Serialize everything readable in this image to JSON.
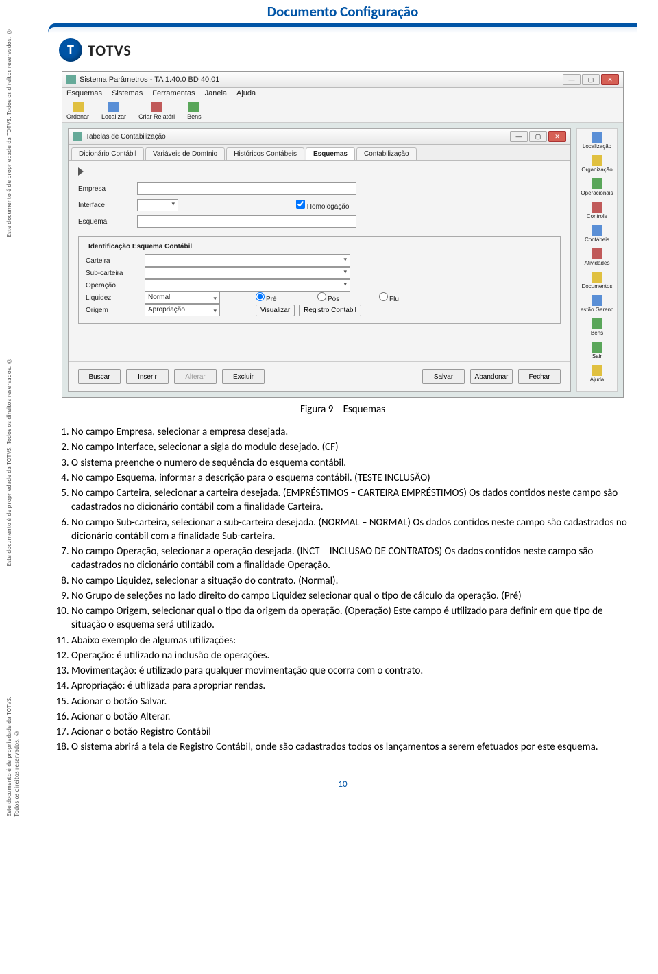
{
  "doc_title": "Documento Configuração",
  "brand": "TOTVS",
  "side_copyright": "Este documento é de propriedade da TOTVS. Todos os direitos reservados. ©",
  "outer_window": {
    "title": "Sistema Parâmetros - TA 1.40.0 BD 40.01",
    "menus": [
      "Esquemas",
      "Sistemas",
      "Ferramentas",
      "Janela",
      "Ajuda"
    ],
    "toolbar": [
      "Ordenar",
      "Localizar",
      "Criar Relatóri",
      "Bens"
    ]
  },
  "inner_window": {
    "title": "Tabelas de Contabilização",
    "tabs": [
      "Dicionário Contábil",
      "Variáveis de Domínio",
      "Históricos Contábeis",
      "Esquemas",
      "Contabilização"
    ],
    "active_tab": "Esquemas",
    "fields": {
      "empresa": "Empresa",
      "interface": "Interface",
      "esquema": "Esquema",
      "homolog": "Homologação",
      "legend": "Identificação Esquema Contábil",
      "carteira": "Carteira",
      "subcarteira": "Sub-carteira",
      "operacao": "Operação",
      "liquidez": "Liquidez",
      "liquidez_val": "Normal",
      "radio_pre": "Pré",
      "radio_pos": "Pós",
      "radio_flu": "Flu",
      "origem": "Origem",
      "origem_val": "Apropriação",
      "visualizar": "Visualizar",
      "registro": "Registro Contabil"
    },
    "buttons": [
      "Buscar",
      "Inserir",
      "Alterar",
      "Excluir",
      "Salvar",
      "Abandonar",
      "Fechar"
    ]
  },
  "side_tools": [
    "Localização",
    "Organização",
    "Operacionais",
    "Controle",
    "Contábeis",
    "Atividades",
    "Documentos",
    "estão Gerenc",
    "Bens",
    "Sair",
    "Ajuda"
  ],
  "figure_caption": "Figura 9 – Esquemas",
  "steps": [
    "No campo Empresa, selecionar a empresa desejada.",
    "No campo Interface, selecionar a sigla do modulo desejado. (CF)",
    "O sistema preenche o numero de sequência do esquema contábil.",
    "No campo Esquema, informar a descrição para o esquema contábil. (TESTE INCLUSÃO)",
    "No campo Carteira, selecionar a carteira desejada. (EMPRÉSTIMOS – CARTEIRA EMPRÉSTIMOS) Os dados contidos neste campo são cadastrados no dicionário contábil com a finalidade Carteira.",
    "No campo Sub-carteira, selecionar a sub-carteira desejada. (NORMAL – NORMAL) Os dados contidos neste campo são cadastrados no dicionário contábil com a finalidade Sub-carteira.",
    "No campo Operação, selecionar a operação desejada. (INCT – INCLUSAO DE CONTRATOS) Os dados contidos neste campo são cadastrados no dicionário contábil com a finalidade Operação.",
    "No campo Liquidez, selecionar a situação do contrato. (Normal).",
    "No Grupo de seleções no lado direito do campo Liquidez selecionar qual o tipo de cálculo da operação. (Pré)",
    "No campo Origem, selecionar qual o tipo da origem da operação. (Operação) Este campo é utilizado para definir em que tipo de situação o esquema será utilizado.",
    "Abaixo exemplo de algumas utilizações:",
    "Operação: é utilizado na inclusão de operações.",
    "Movimentação: é utilizado para qualquer movimentação que ocorra com o contrato.",
    "Apropriação: é utilizada para apropriar rendas.",
    "Acionar o botão Salvar.",
    "Acionar o botão Alterar.",
    "Acionar o botão Registro Contábil",
    "O sistema abrirá a tela de Registro Contábil, onde são cadastrados todos os lançamentos a serem efetuados por este esquema."
  ],
  "page_number": "10"
}
